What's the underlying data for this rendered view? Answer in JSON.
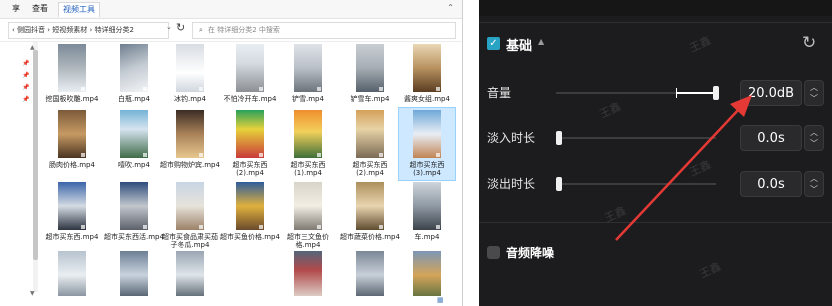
{
  "explorer": {
    "ribbon": {
      "tabs": [
        "享",
        "查看",
        "视频工具"
      ],
      "active_index": 2
    },
    "address": {
      "path": "‹ 侧园抖音 › 短视频素材 › 特详细分类2",
      "search_placeholder": "在 特详细分类2 中搜索"
    },
    "files": [
      {
        "name": "挖国板吹雕.mp4"
      },
      {
        "name": "白瓶.mp4"
      },
      {
        "name": "冰钓.mp4"
      },
      {
        "name": "不怕冷开车.mp4"
      },
      {
        "name": "铲雪.mp4"
      },
      {
        "name": "铲雪车.mp4"
      },
      {
        "name": "酱爽女组.mp4"
      },
      {
        "name": "肠肉价格.mp4"
      },
      {
        "name": "噎吹.mp4"
      },
      {
        "name": "超市购物炉宾.mp4"
      },
      {
        "name": "超市买东西(2).mp4"
      },
      {
        "name": "超市买东西(1).mp4"
      },
      {
        "name": "超市买东西(2).mp4"
      },
      {
        "name": "超市买东西(3).mp4"
      },
      {
        "name": "超市买东西.mp4"
      },
      {
        "name": "超市买东西活.mp4"
      },
      {
        "name": "超市买食品肃买茄子冬瓜.mp4"
      },
      {
        "name": "超市买鱼价格.mp4"
      },
      {
        "name": "超市三文鱼价格.mp4"
      },
      {
        "name": "超市蔬菜价格.mp4"
      },
      {
        "name": "车.mp4"
      },
      {
        "name": ""
      },
      {
        "name": ""
      },
      {
        "name": ""
      },
      {
        "name": ""
      },
      {
        "name": ""
      },
      {
        "name": ""
      }
    ],
    "selected_file_index": 13
  },
  "panel": {
    "section_title": "基础",
    "section_enabled": true,
    "rows": [
      {
        "label": "音量",
        "value": "20.0dB",
        "level": 1.0
      },
      {
        "label": "淡入时长",
        "value": "0.0s",
        "level": 0.0
      },
      {
        "label": "淡出时长",
        "value": "0.0s",
        "level": 0.0
      }
    ],
    "noise_reduction_label": "音频降噪",
    "noise_reduction_enabled": false,
    "watermark_text": "王鑫"
  },
  "colors": {
    "panel_bg": "#1c1c1e",
    "accent_checkbox": "#29a3c4",
    "annotation_arrow": "#e53935",
    "explorer_selection": "#cde8ff"
  },
  "icons": [
    "pin-icon",
    "search-icon",
    "refresh-icon",
    "reset-icon",
    "check-icon",
    "caret-up-icon",
    "stepper-icon"
  ]
}
